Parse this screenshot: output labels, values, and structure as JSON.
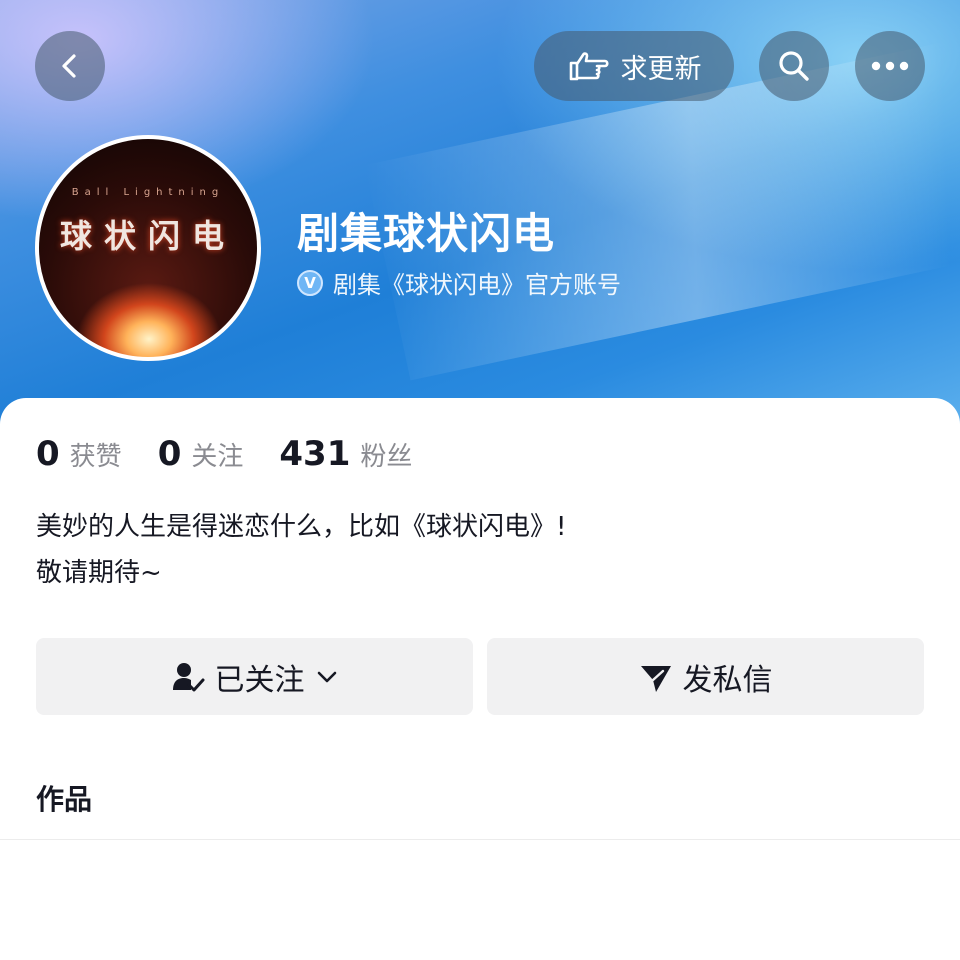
{
  "header": {
    "request_update_label": "求更新",
    "account_name": "剧集球状闪电",
    "verification_text": "剧集《球状闪电》官方账号",
    "verification_badge": "V"
  },
  "avatar": {
    "title_text": "球状闪电",
    "subtitle_text": "Ball Lightning"
  },
  "stats": [
    {
      "value": "0",
      "label": "获赞"
    },
    {
      "value": "0",
      "label": "关注"
    },
    {
      "value": "431",
      "label": "粉丝"
    }
  ],
  "bio": {
    "line1": "美妙的人生是得迷恋什么，比如《球状闪电》!",
    "line2": "敬请期待~"
  },
  "actions": {
    "follow_label": "已关注",
    "message_label": "发私信"
  },
  "tabs": {
    "works_label": "作品"
  },
  "colors": {
    "header_blue": "#1f7fd7",
    "button_bg": "#f1f1f2",
    "secondary_text": "#8a8b91"
  }
}
